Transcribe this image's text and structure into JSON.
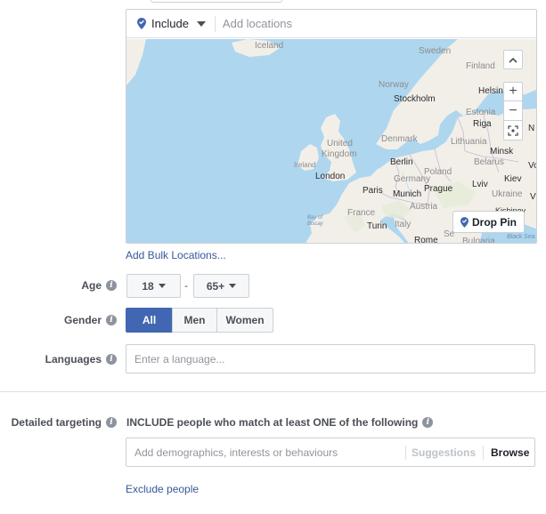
{
  "location": {
    "include_label": "Include",
    "input_placeholder": "Add locations",
    "drop_pin_label": "Drop Pin",
    "bulk_link": "Add Bulk Locations...",
    "map_controls": {
      "up": "^",
      "zoom_in": "+",
      "zoom_out": "−"
    },
    "map_labels": {
      "iceland": "Iceland",
      "sweden": "Sweden",
      "finland": "Finland",
      "norway": "Norway",
      "stockholm": "Stockholm",
      "helsinki": "Helsin",
      "estonia": "Estonia",
      "riga": "Riga",
      "n_edge": "N",
      "denmark": "Denmark",
      "lithuania": "Lithuania",
      "united": "United",
      "kingdom": "Kingdom",
      "minsk": "Minsk",
      "ireland": "Ireland",
      "berlin": "Berlin",
      "belarus": "Belarus",
      "vo": "Vo",
      "poland": "Poland",
      "london": "London",
      "germany": "Germany",
      "kiev": "Kiev",
      "lviv": "Lviv",
      "paris": "Paris",
      "munich": "Munich",
      "prague": "Prague",
      "ukraine": "Ukraine",
      "v_edge": "V",
      "austria": "Austria",
      "kishinev": "Kishinev",
      "france": "France",
      "bay": "Bay of",
      "biscay": "Biscay",
      "turin": "Turin",
      "italy": "Italy",
      "serb": "Se",
      "rome": "Rome",
      "bulgaria": "Bulgaria",
      "black_sea": "Black Sea"
    }
  },
  "age": {
    "label": "Age",
    "min": "18",
    "dash": "-",
    "max": "65+"
  },
  "gender": {
    "label": "Gender",
    "options": [
      "All",
      "Men",
      "Women"
    ],
    "selected": "All"
  },
  "languages": {
    "label": "Languages",
    "placeholder": "Enter a language..."
  },
  "detailed_targeting": {
    "label": "Detailed targeting",
    "include_text": "INCLUDE people who match at least ONE of the following",
    "placeholder": "Add demographics, interests or behaviours",
    "suggestions_label": "Suggestions",
    "browse_label": "Browse",
    "exclude_link": "Exclude people"
  },
  "info_glyph": "i",
  "colors": {
    "link": "#365899",
    "brand_blue": "#4267b2",
    "selected_segment": "#4267b2",
    "water": "#aed6ef",
    "land": "#f2efe9"
  }
}
